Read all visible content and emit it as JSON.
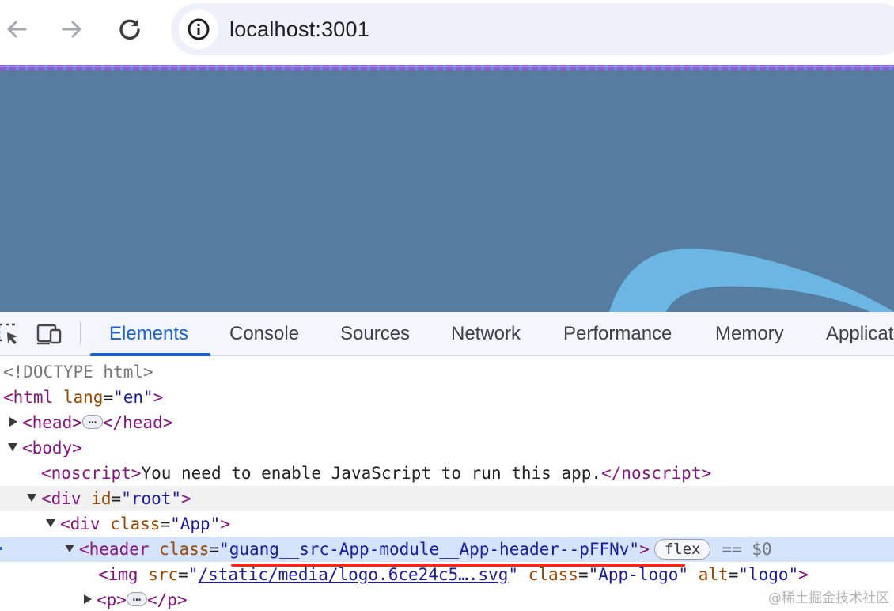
{
  "browser": {
    "url": "localhost:3001",
    "back_icon": "arrow-left-icon",
    "forward_icon": "arrow-right-icon",
    "reload_icon": "reload-icon",
    "site_info_icon": "info-circle-icon"
  },
  "page": {
    "background_color": "#567c9f",
    "logo_color": "#6bb6e3"
  },
  "devtools": {
    "tabs": [
      {
        "label": "Elements",
        "active": true
      },
      {
        "label": "Console",
        "active": false
      },
      {
        "label": "Sources",
        "active": false
      },
      {
        "label": "Network",
        "active": false
      },
      {
        "label": "Performance",
        "active": false
      },
      {
        "label": "Memory",
        "active": false
      },
      {
        "label": "Applicat",
        "active": false
      }
    ],
    "accent_color": "#1a5fd6"
  },
  "tree": {
    "doctype": "<!DOCTYPE html>",
    "html_open": "<html",
    "html_attr": "lang",
    "html_val": "\"en\"",
    "html_close": ">",
    "head_open": "<head>",
    "head_close": "</head>",
    "body_open": "<body>",
    "noscript_open": "<noscript>",
    "noscript_text": "You need to enable JavaScript to run this app.",
    "noscript_close": "</noscript>",
    "div_root_open": "<div",
    "div_root_attr": "id",
    "div_root_val": "\"root\"",
    "div_app_open": "<div",
    "div_app_attr": "class",
    "div_app_val": "\"App\"",
    "header_open": "<header",
    "header_attr": "class",
    "header_val": "\"guang__src-App-module__App-header--pFFNv\"",
    "header_badge": "flex",
    "selected_marker": "== $0",
    "img_open": "<img",
    "img_src_attr": "src",
    "img_src_val": "/static/media/logo.6ce24c5….svg",
    "img_class_attr": "class",
    "img_class_val": "\"App-logo\"",
    "img_alt_attr": "alt",
    "img_alt_val": "\"logo\"",
    "p_open": "<p>",
    "p_close": "</p>",
    "gt": ">",
    "eq": "=",
    "quote": "\""
  },
  "watermark": "@稀土掘金技术社区"
}
